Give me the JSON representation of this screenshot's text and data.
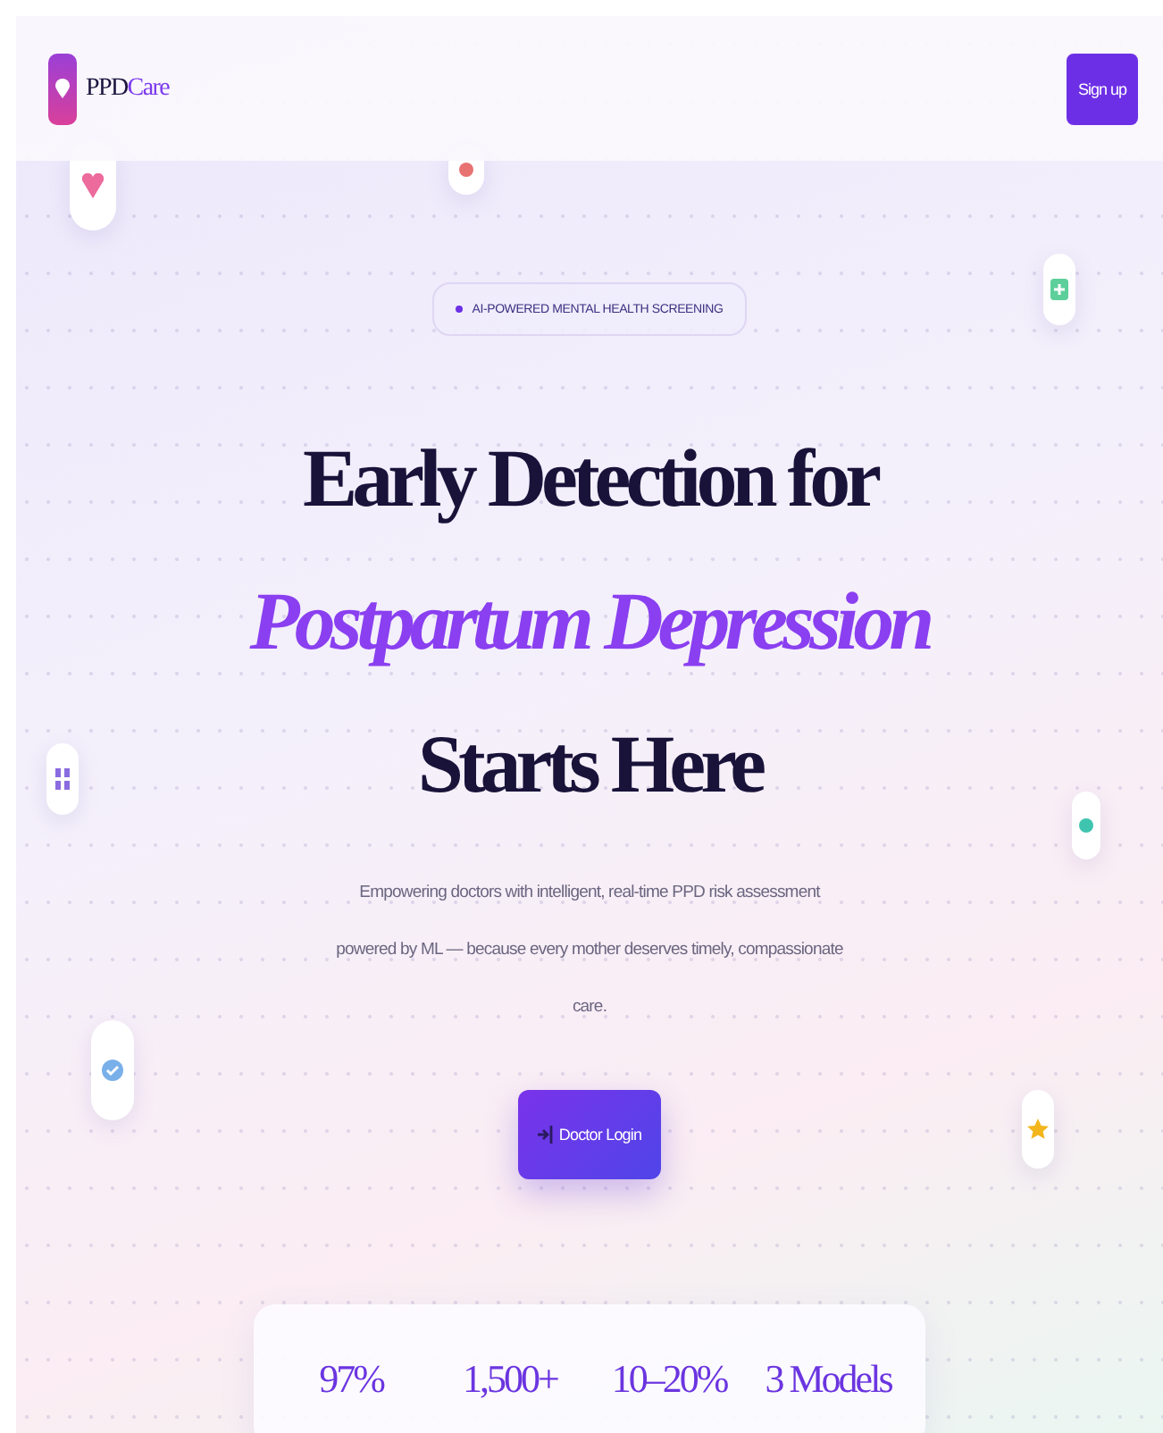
{
  "header": {
    "logo_prefix": "PPD",
    "logo_suffix": "Care",
    "signup": "Sign up"
  },
  "badge": "AI-POWERED MENTAL HEALTH SCREENING",
  "headline": {
    "line_1": "Early Detection for",
    "line_2": "Postpartum Depression",
    "line_3": "Starts Here"
  },
  "subtitle": "Empowering doctors with intelligent, real-time PPD risk assessment powered by ML — because every mother deserves timely, compassionate care.",
  "cta": "Doctor Login",
  "stats": [
    "97%",
    "1,500+",
    "10–20%",
    "3 Models"
  ]
}
